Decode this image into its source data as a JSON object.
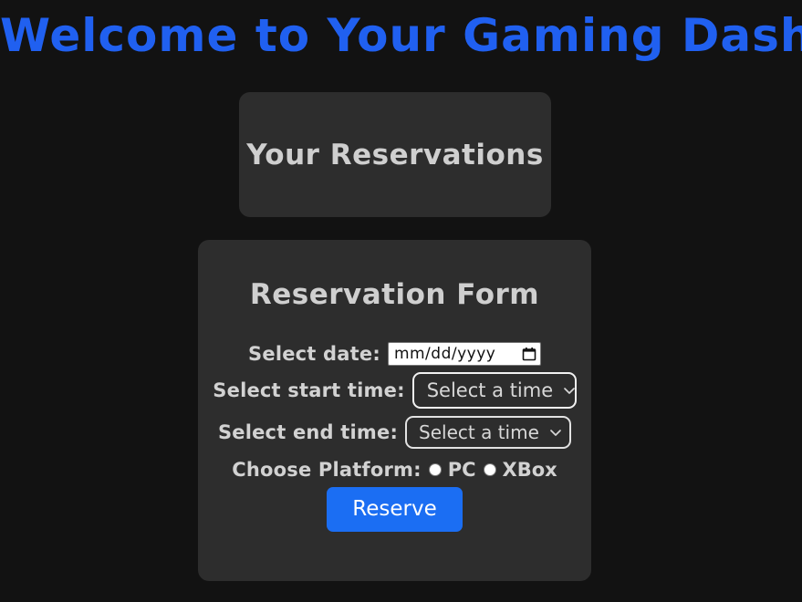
{
  "page": {
    "title": "Welcome to Your Gaming Dashboard",
    "background_color": "#121212",
    "title_color": "#2060f0"
  },
  "reservations_card": {
    "heading": "Your Reservations",
    "background_color": "#2d2d2d",
    "text_color": "#cfcfcf"
  },
  "form": {
    "heading": "Reservation Form",
    "background_color": "#2d2d2d",
    "fields": {
      "date": {
        "label": "Select date:",
        "value": "",
        "placeholder": "mm/dd/yyyy",
        "icon": "calendar-icon"
      },
      "start_time": {
        "label": "Select start time:",
        "selected": "Select a time",
        "icon": "chevron-down-icon",
        "focused": true
      },
      "end_time": {
        "label": "Select end time:",
        "selected": "Select a time",
        "icon": "chevron-down-icon",
        "focused": false
      },
      "platform": {
        "label": "Choose Platform:",
        "options": [
          {
            "label": "PC",
            "checked": false
          },
          {
            "label": "XBox",
            "checked": false
          }
        ]
      }
    },
    "submit": {
      "label": "Reserve",
      "color": "#1b6ef3",
      "text_color": "#ffffff"
    }
  }
}
